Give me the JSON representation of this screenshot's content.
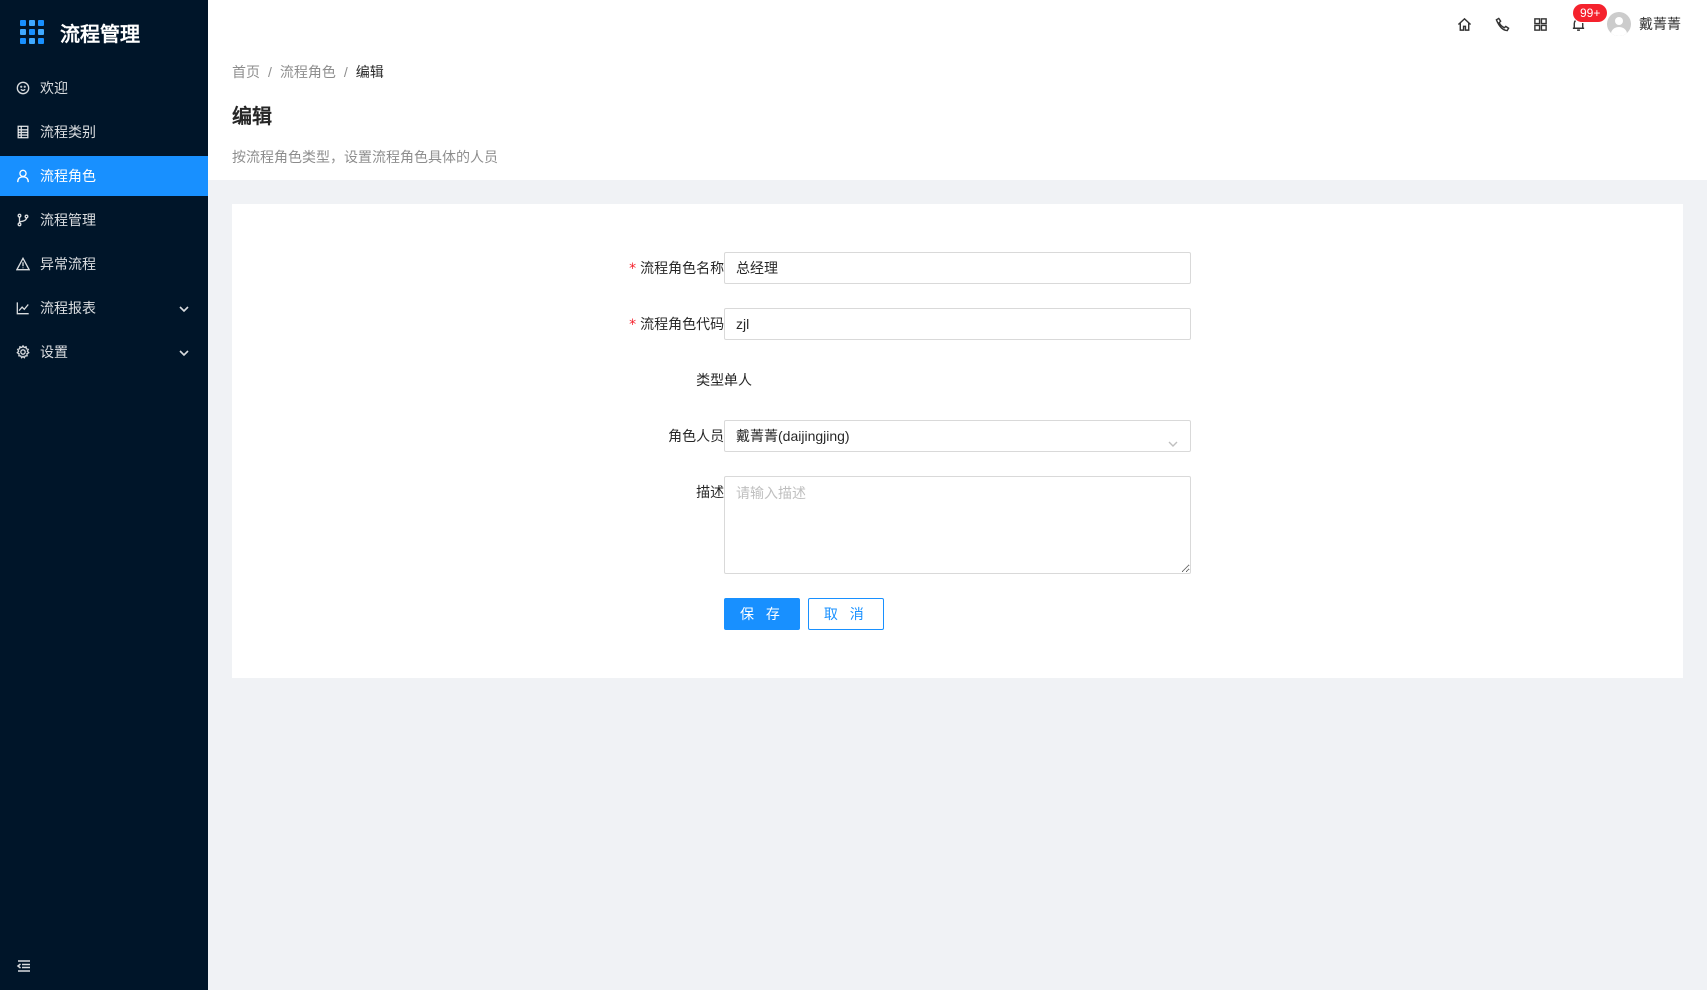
{
  "app": {
    "title": "流程管理"
  },
  "sidebar": {
    "items": [
      {
        "label": "欢迎",
        "icon": "smile-icon",
        "active": false
      },
      {
        "label": "流程类别",
        "icon": "table-icon",
        "active": false
      },
      {
        "label": "流程角色",
        "icon": "user-icon",
        "active": true
      },
      {
        "label": "流程管理",
        "icon": "branch-icon",
        "active": false
      },
      {
        "label": "异常流程",
        "icon": "warning-icon",
        "active": false
      },
      {
        "label": "流程报表",
        "icon": "line-chart-icon",
        "active": false,
        "has_children": true
      },
      {
        "label": "设置",
        "icon": "setting-icon",
        "active": false,
        "has_children": true
      }
    ]
  },
  "header": {
    "notification_count": "99+",
    "user_name": "戴菁菁"
  },
  "breadcrumb": {
    "items": [
      "首页",
      "流程角色",
      "编辑"
    ],
    "separator": "/"
  },
  "page": {
    "title": "编辑",
    "description": "按流程角色类型，设置流程角色具体的人员"
  },
  "form": {
    "name": {
      "label": "流程角色名称:",
      "value": "总经理",
      "required": true
    },
    "code": {
      "label": "流程角色代码:",
      "value": "zjl",
      "required": true
    },
    "type": {
      "label": "类型:",
      "value": "单人"
    },
    "members": {
      "label": "角色人员:",
      "value": "戴菁菁(daijingjing)"
    },
    "description": {
      "label": "描述:",
      "value": "",
      "placeholder": "请输入描述"
    },
    "save_label": "保 存",
    "cancel_label": "取 消"
  },
  "colors": {
    "sidebar_bg": "#001529",
    "primary": "#1890ff",
    "badge": "#f5222d",
    "page_bg": "#f0f2f5"
  }
}
